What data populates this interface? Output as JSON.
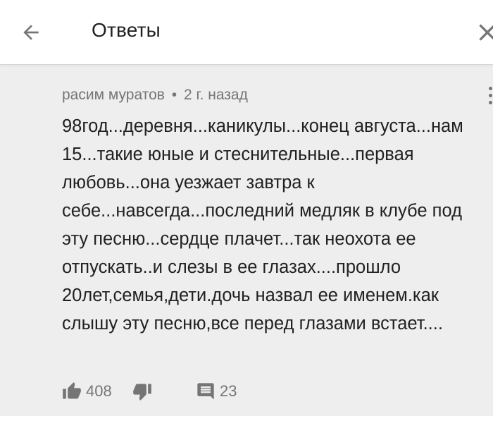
{
  "header": {
    "title": "Ответы"
  },
  "comment": {
    "author": "расим муратов",
    "separator": "•",
    "time": "2 г. назад",
    "text": "98год...деревня...каникулы...конец августа...нам 15...такие юные и стеснительные...первая любовь...она уезжает завтра к себе...навсегда...последний медляк в клубе под эту песню...сердце плачет...так неохота ее отпускать..и слезы в ее глазах....прошло 20лет,семья,дети.дочь назвал ее именем.как слышу эту песню,все перед глазами встает....",
    "likes": "408",
    "replies": "23"
  },
  "colors": {
    "background": "#eeeeee",
    "text": "#212121",
    "secondary": "#757575"
  }
}
